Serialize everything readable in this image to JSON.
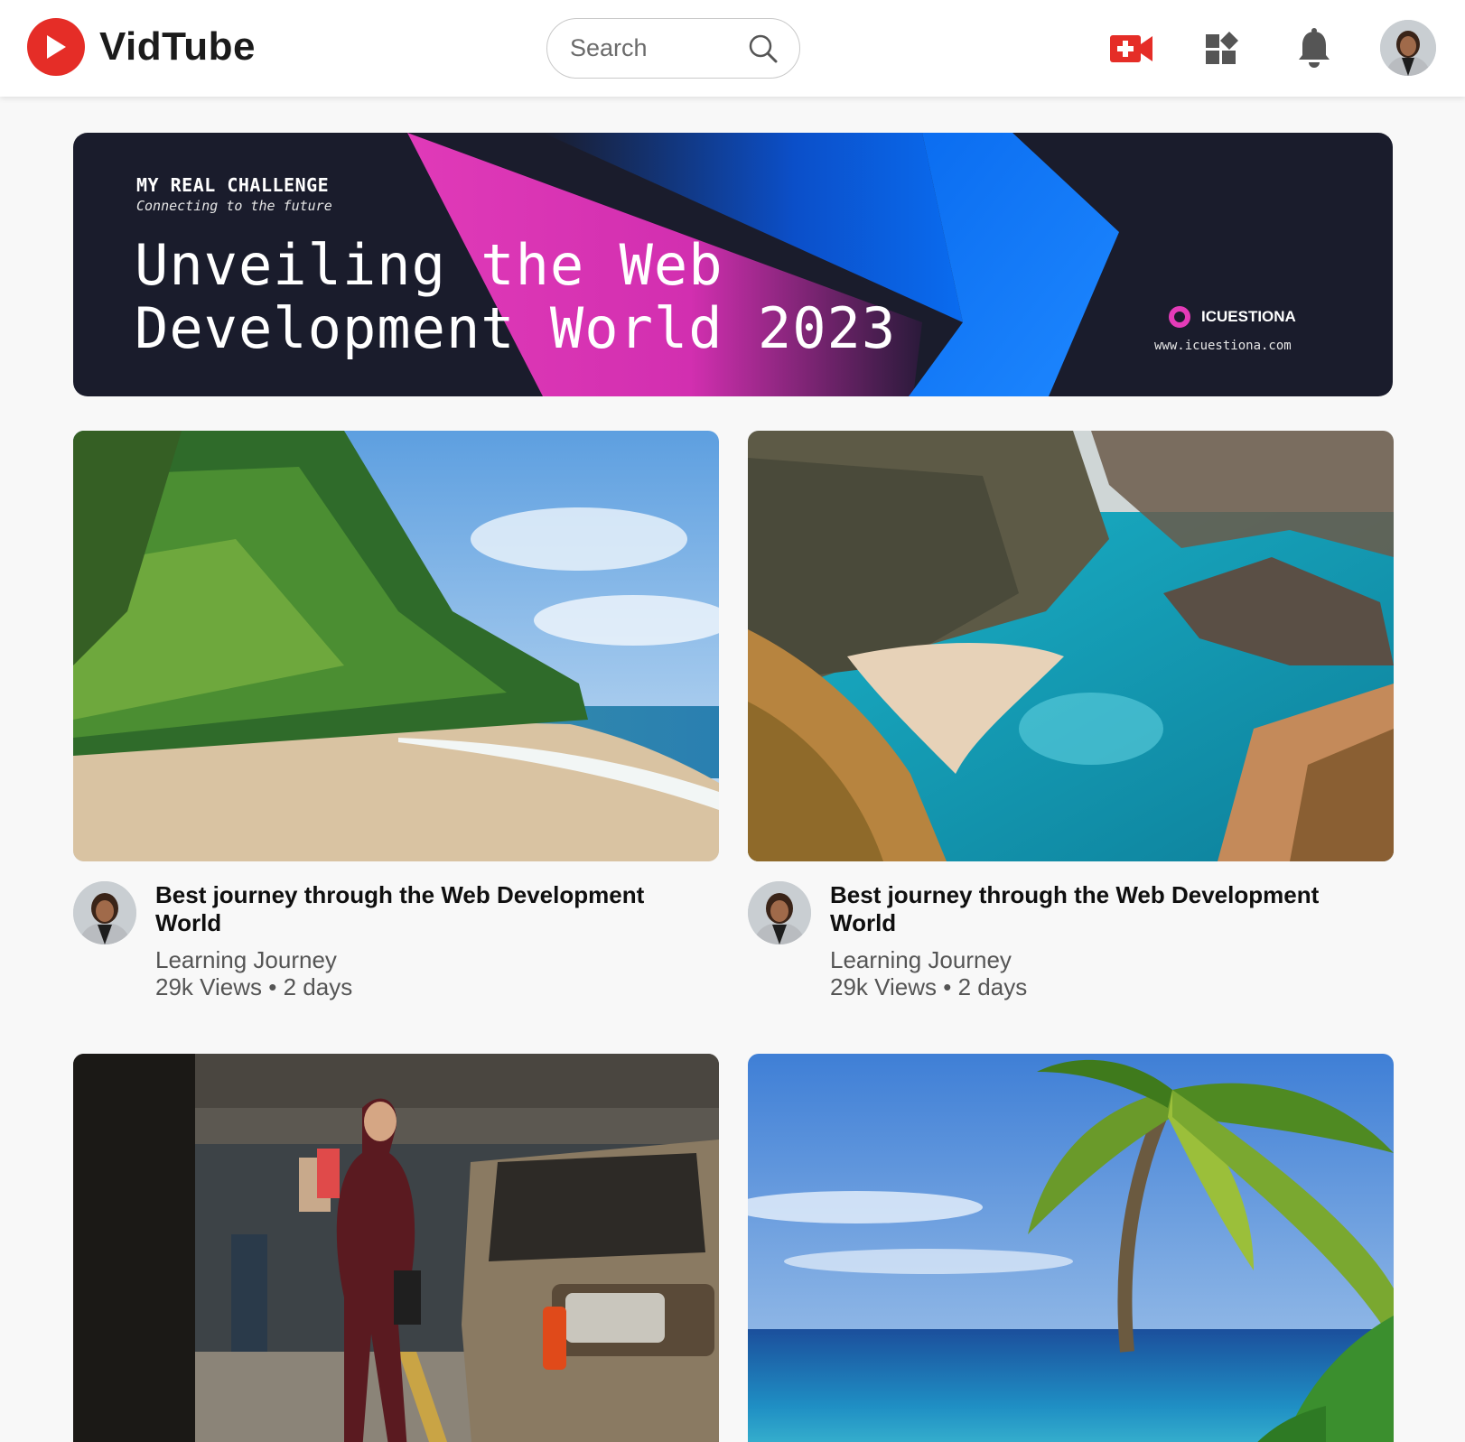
{
  "app": {
    "name": "VidTube"
  },
  "header": {
    "search_placeholder": "Search",
    "icons": [
      "create-video-icon",
      "apps-icon",
      "bell-icon",
      "user-avatar"
    ],
    "accent": "#e52d27"
  },
  "banner": {
    "kicker": "MY REAL CHALLENGE",
    "subtitle": "Connecting to the future",
    "title_line1": "Unveiling the Web",
    "title_line2": "Development World 2023",
    "brand": "ICUESTIONA",
    "url": "www.icuestiona.com",
    "colors": {
      "bg": "#1a1c2c",
      "magenta": "#e03ab8",
      "blue": "#1a73e8"
    }
  },
  "videos": [
    {
      "title": "Best journey through the Web Development World",
      "channel": "Learning Journey",
      "views": "29k Views",
      "age": "2 days",
      "thumbnail": "tropical-beach-palms"
    },
    {
      "title": "Best journey through the Web Development World",
      "channel": "Learning Journey",
      "views": "29k Views",
      "age": "2 days",
      "thumbnail": "rocky-coast-cove"
    },
    {
      "title": "",
      "channel": "",
      "views": "",
      "age": "",
      "thumbnail": "parking-garage-shopper"
    },
    {
      "title": "",
      "channel": "",
      "views": "",
      "age": "",
      "thumbnail": "palm-sea-horizon"
    }
  ]
}
